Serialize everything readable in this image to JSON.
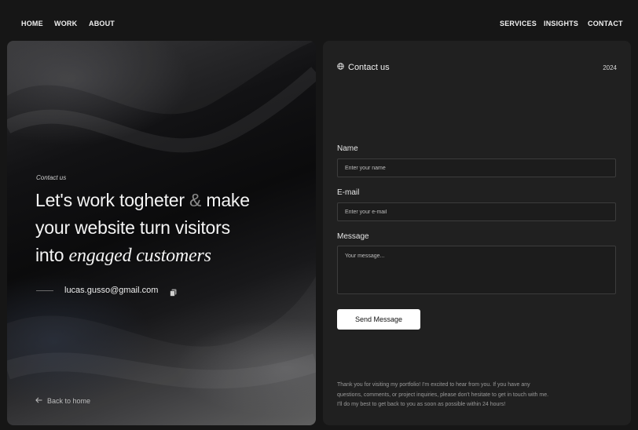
{
  "nav": {
    "left": [
      "HOME",
      "WORK",
      "ABOUT"
    ],
    "right": [
      "SERVICES",
      "INSIGHTS",
      "CONTACT"
    ]
  },
  "hero": {
    "kicker": "Contact us",
    "headline": {
      "part1": "Let's work togheter",
      "amp": "&",
      "part2": "make",
      "line2": "your website turn visitors",
      "line3_plain": "into",
      "line3_em": "engaged customers"
    },
    "email": "lucas.gusso@gmail.com",
    "back_label": "Back to home",
    "icons": {
      "copy": "copy-icon",
      "back": "arrow-left-icon"
    }
  },
  "contact": {
    "title": "Contact us",
    "year": "2024",
    "icons": {
      "title": "globe-icon"
    },
    "fields": {
      "name_label": "Name",
      "name_placeholder": "Enter your name",
      "email_label": "E-mail",
      "email_placeholder": "Enter your e-mail",
      "message_label": "Message",
      "message_placeholder": "Your message..."
    },
    "submit_label": "Send Message",
    "note_lines": [
      "Thank you for visiting my portfolio! I'm excited to hear from you. If you have any",
      "questions, comments, or project inquiries, please don't hesitate to get in touch with me.",
      "I'll do my best to get back to you as soon as possible within 24 hours!"
    ]
  },
  "colors": {
    "background": "#161616",
    "panel": "#202020",
    "button": "#ffffff",
    "text": "#eaeaea"
  }
}
